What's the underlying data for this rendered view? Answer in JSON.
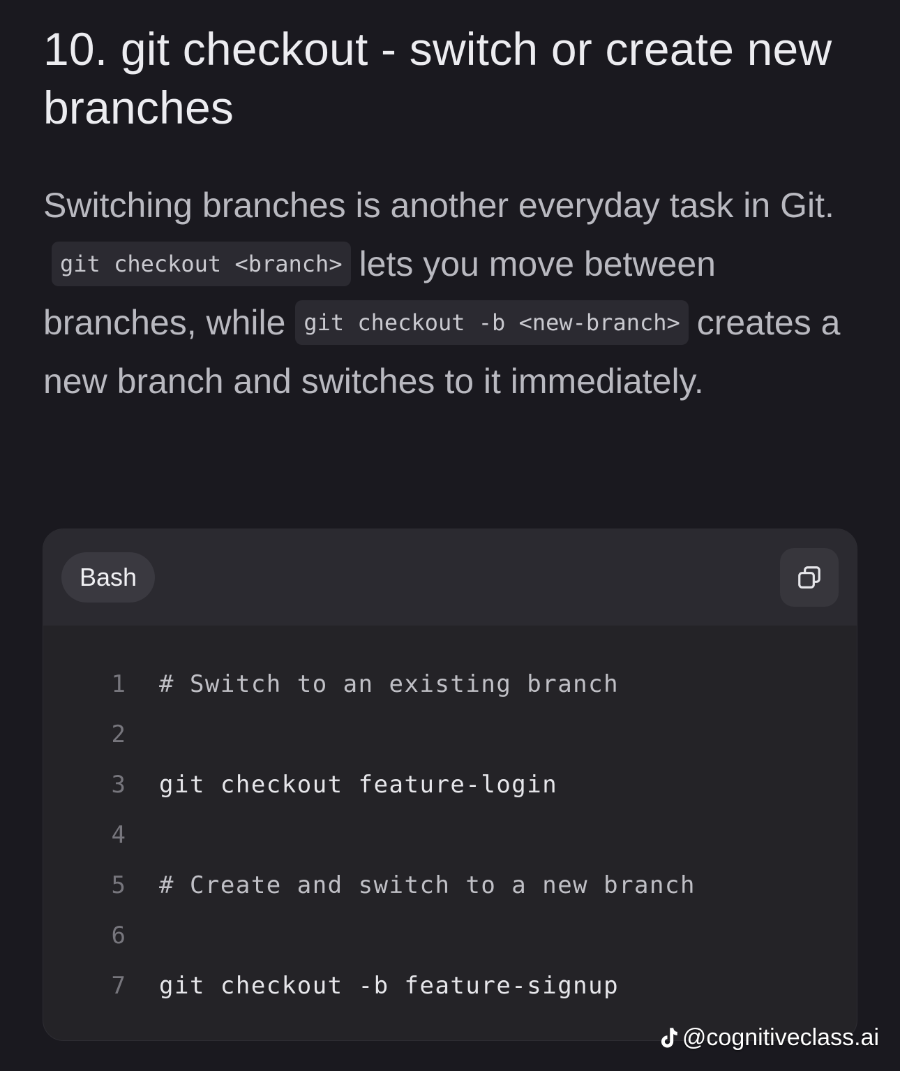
{
  "article": {
    "heading": "10. git checkout - switch or create new branches",
    "para": {
      "part1": "Switching branches is another everyday task in Git.",
      "code1": "git checkout <branch>",
      "part2": "lets you move between branches, while",
      "code2": "git checkout -b <new-branch>",
      "part3": "creates a new branch and switches to it immediately."
    }
  },
  "code_block": {
    "language": "Bash",
    "copy_icon": "copy-icon",
    "lines": [
      {
        "number": "1",
        "text": "# Switch to an existing branch"
      },
      {
        "number": "2",
        "text": ""
      },
      {
        "number": "3",
        "text": "git checkout feature-login"
      },
      {
        "number": "4",
        "text": ""
      },
      {
        "number": "5",
        "text": "# Create and switch to a new branch"
      },
      {
        "number": "6",
        "text": ""
      },
      {
        "number": "7",
        "text": "git checkout -b feature-signup"
      }
    ]
  },
  "watermark": {
    "icon": "tiktok-icon",
    "handle": "@cognitiveclass.ai"
  }
}
